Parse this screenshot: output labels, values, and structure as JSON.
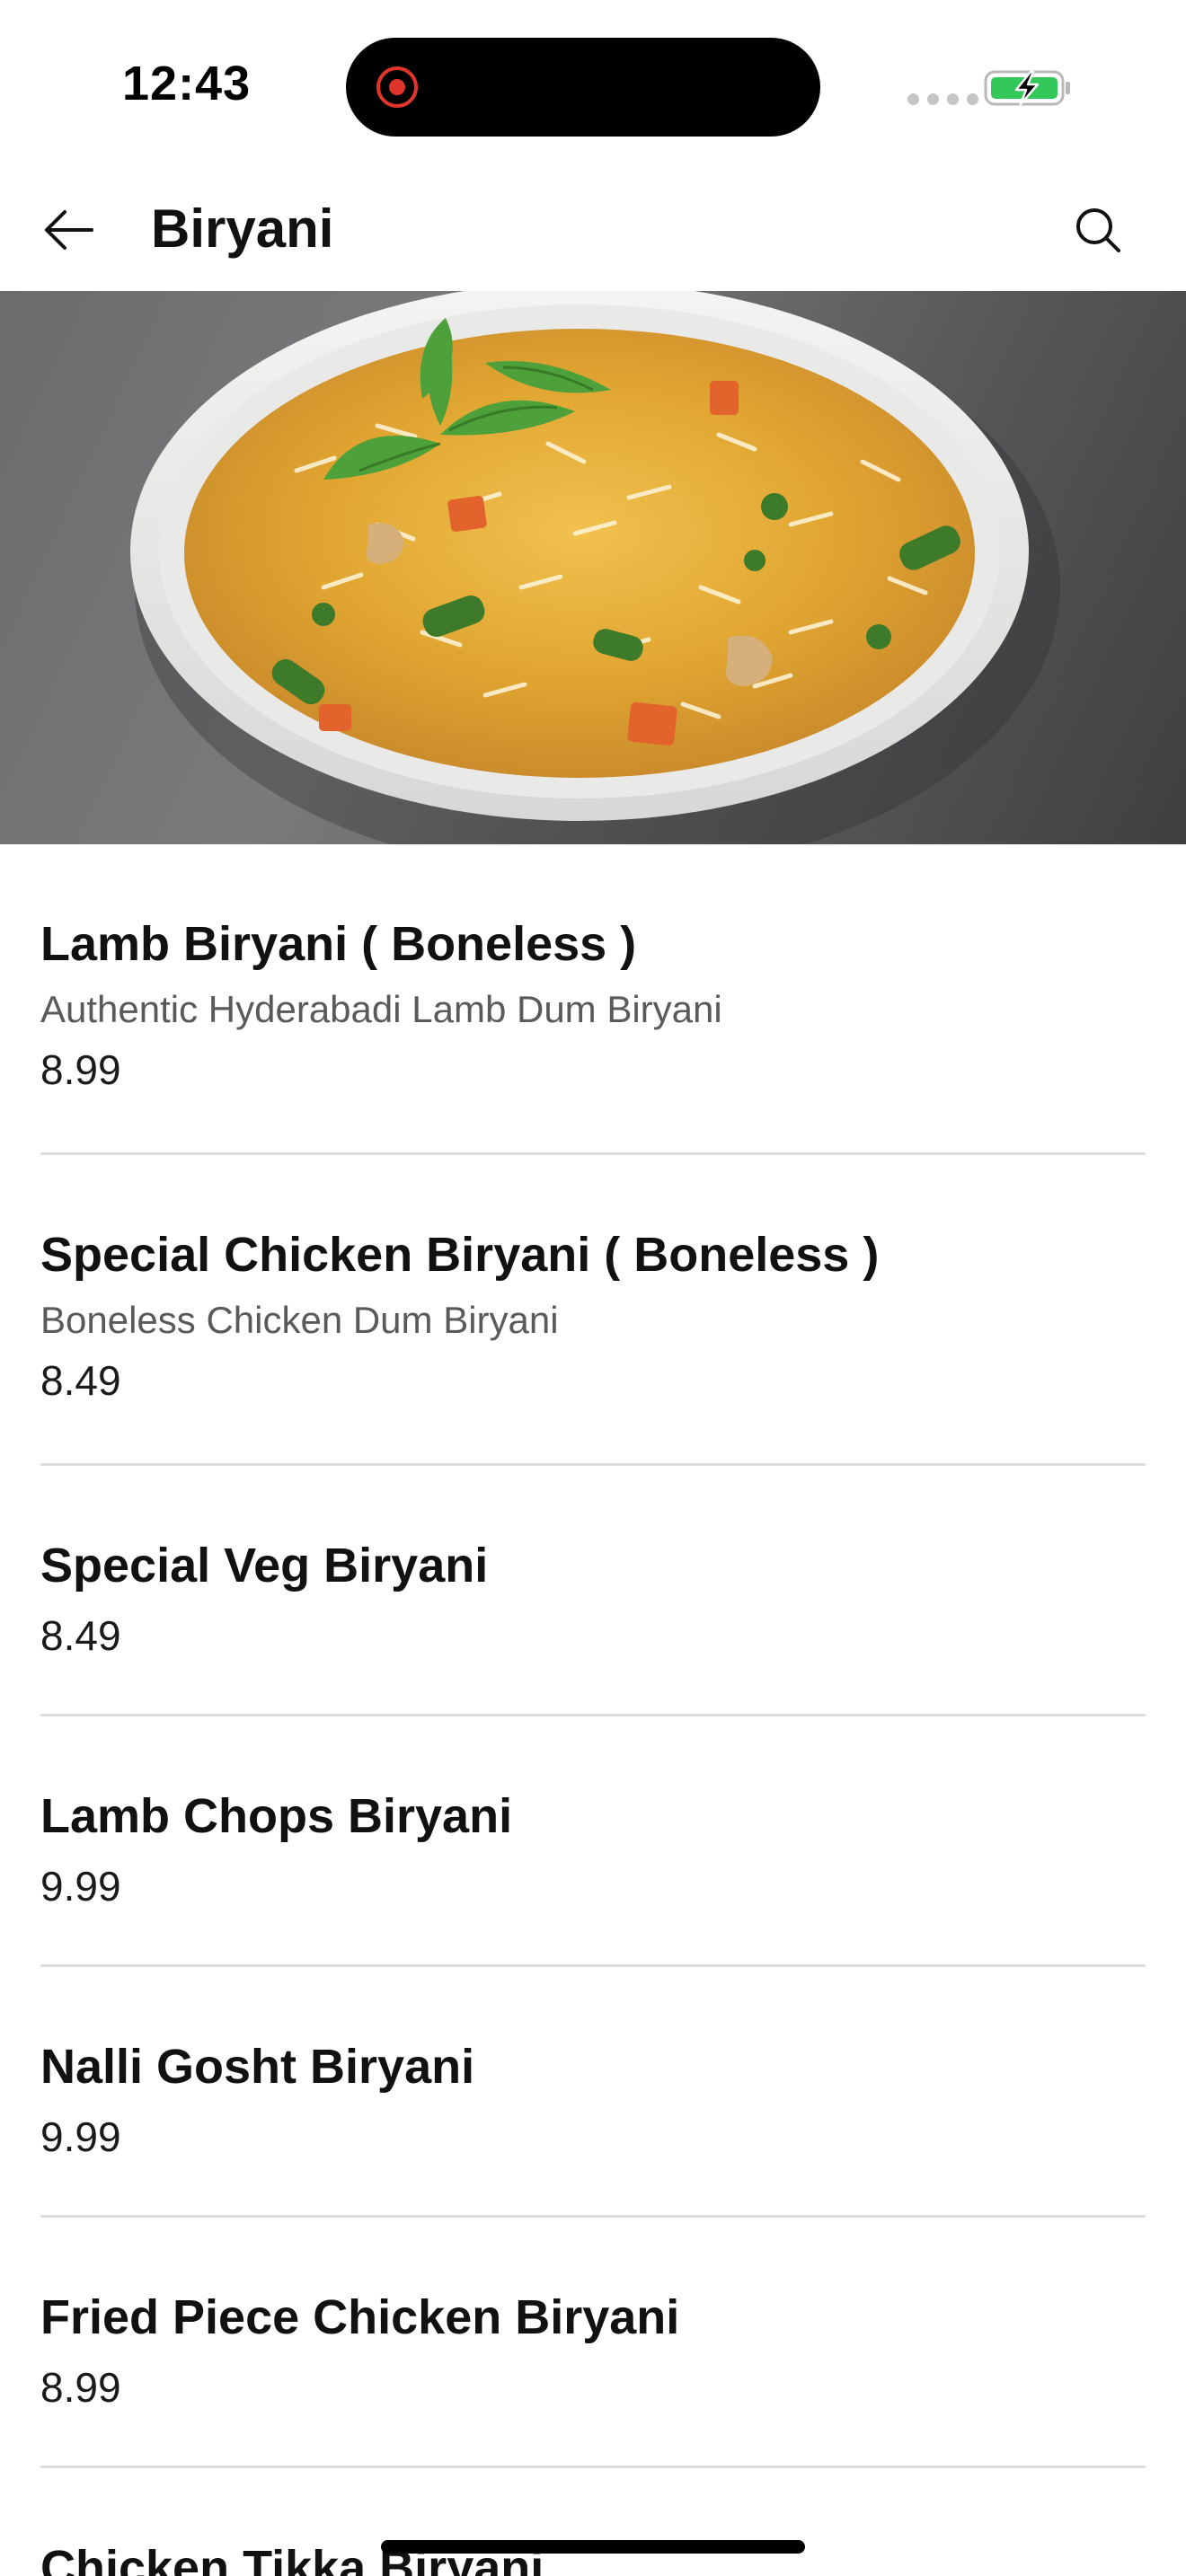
{
  "status_bar": {
    "time": "12:43",
    "battery_state": "charging",
    "accent_colors": {
      "battery": "#34c759",
      "recording": "#e0352b"
    }
  },
  "header": {
    "title": "Biryani",
    "back_icon": "arrow-left-icon",
    "search_icon": "search-icon"
  },
  "hero": {
    "icon": "biryani-bowl-photo"
  },
  "menu": {
    "items": [
      {
        "name": "Lamb Biryani ( Boneless )",
        "description": "Authentic Hyderabadi Lamb Dum Biryani",
        "price": "8.99"
      },
      {
        "name": "Special Chicken Biryani ( Boneless )",
        "description": "Boneless Chicken Dum Biryani",
        "price": "8.49"
      },
      {
        "name": "Special Veg Biryani",
        "price": "8.49"
      },
      {
        "name": "Lamb Chops Biryani",
        "price": "9.99"
      },
      {
        "name": "Nalli Gosht Biryani",
        "price": "9.99"
      },
      {
        "name": "Fried Piece Chicken Biryani",
        "price": "8.99"
      },
      {
        "name": "Chicken Tikka Biryani"
      }
    ]
  }
}
